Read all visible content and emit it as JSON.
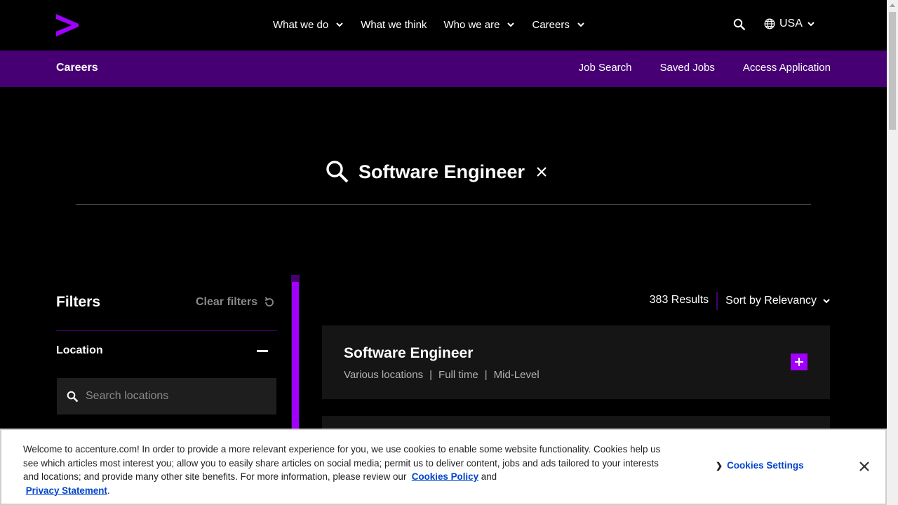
{
  "nav": {
    "logo_alt": "Accenture",
    "links": [
      {
        "label": "What we do",
        "has_dropdown": true
      },
      {
        "label": "What we think",
        "has_dropdown": false
      },
      {
        "label": "Who we are",
        "has_dropdown": true
      },
      {
        "label": "Careers",
        "has_dropdown": true
      }
    ],
    "region": "USA",
    "icons": [
      "search-icon",
      "globe-icon",
      "chevron-down-icon"
    ]
  },
  "subbar": {
    "title": "Careers",
    "links": [
      "Job Search",
      "Saved Jobs",
      "Access Application"
    ]
  },
  "search": {
    "query": "Software Engineer"
  },
  "filters": {
    "title": "Filters",
    "clear_label": "Clear filters",
    "location_label": "Location",
    "location_placeholder": "Search locations"
  },
  "results": {
    "count": "383 Results",
    "sort_label": "Sort by Relevancy",
    "jobs": [
      {
        "title": "Software Engineer",
        "location": "Various locations",
        "type": "Full time",
        "level": "Mid-Level"
      }
    ]
  },
  "cookie": {
    "text_before": "Welcome to accenture.com! In order to provide a more relevant experience for you, we use cookies to enable some website functionality. Cookies help us see which articles most interest you; allow you to easily share articles on social media; permit us to deliver content, jobs and ads tailored to your interests and locations; and provide many other site benefits. For more information, please review our",
    "policy_link": "Cookies Policy",
    "and": "and",
    "privacy_link": "Privacy Statement",
    "period": ".",
    "settings_label": "Cookies Settings"
  },
  "colors": {
    "accent_purple": "#a100ff",
    "dark_purple": "#460073",
    "background": "#000000",
    "link_blue": "#0044cc"
  }
}
